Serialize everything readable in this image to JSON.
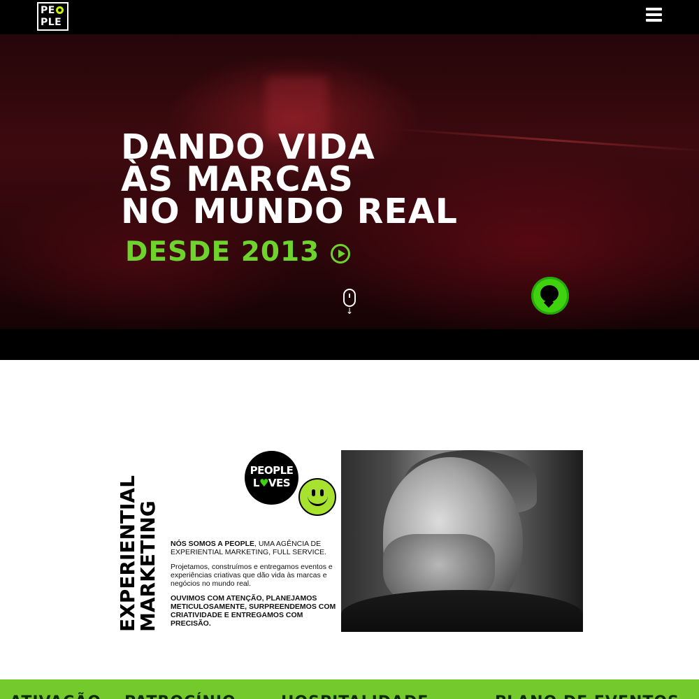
{
  "header": {
    "logo": {
      "line1": "PE",
      "line1_o": "O",
      "line2": "PLE"
    },
    "menu_icon": "hamburger-menu-icon"
  },
  "hero": {
    "title_lines": [
      "DANDO VIDA",
      "ÀS MARCAS",
      "NO MUNDO REAL"
    ],
    "subtitle": "DESDE 2013",
    "play_icon": "play-circle-icon",
    "scroll_icon": "mouse-scroll-icon",
    "chat_icon": "chat-bubble-icon"
  },
  "about": {
    "vertical_title": [
      "EXPERIENTIAL",
      "MARKETING"
    ],
    "badge": {
      "line1": "PEOPLE",
      "line2_pre": "L",
      "line2_heart": "♥",
      "line2_post": "VES"
    },
    "smiley_icon": "smiley-face-icon",
    "para1_strong": "NÓS SOMOS A PEOPLE",
    "para1_rest": ", UMA AGÊNCIA DE EXPERIENTIAL MARKETING, FULL SERVICE.",
    "para2": "Projetamos, construímos e entregamos eventos e experiências criativas que dão vida às marcas e negócios no mundo real.",
    "para3": "OUVIMOS COM ATENÇÃO, PLANEJAMOS METICULOSAMENTE, SURPREENDEMOS COM CRIATIVIDADE E ENTREGAMOS COM PRECISÃO."
  },
  "bottom_bar": {
    "categories": [
      "ATIVAÇÃO",
      "PATROCÍNIO",
      "HOSPITALIDADE",
      "PLANO DE EVENTOS"
    ]
  },
  "colors": {
    "accent_green": "#6ed32c",
    "logo_ring": "#c8f000",
    "bottom_bar": "#74c92c"
  }
}
